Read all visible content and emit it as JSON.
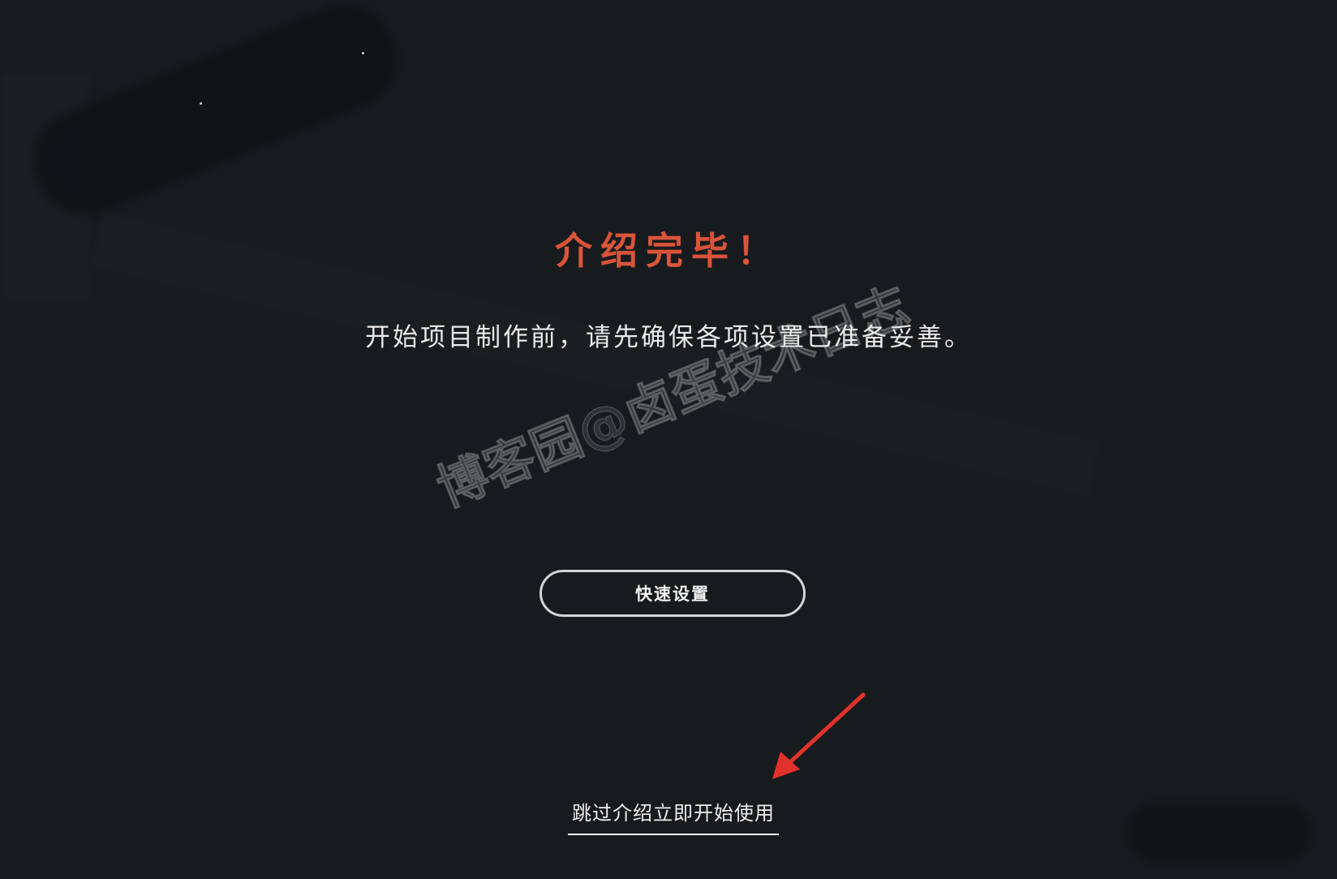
{
  "intro": {
    "title": "介绍完毕！",
    "subtitle": "开始项目制作前，请先确保各项设置已准备妥善。",
    "quick_setup_label": "快速设置",
    "skip_label": "跳过介绍立即开始使用"
  },
  "watermark": {
    "text": "博客园@卤蛋技术日志"
  },
  "colors": {
    "background": "#181b1e",
    "title": "#d9543a",
    "text": "#e9e9e9",
    "annotation_arrow": "#e0322b"
  },
  "icons": {
    "annotation": "arrow-pointer-icon"
  }
}
